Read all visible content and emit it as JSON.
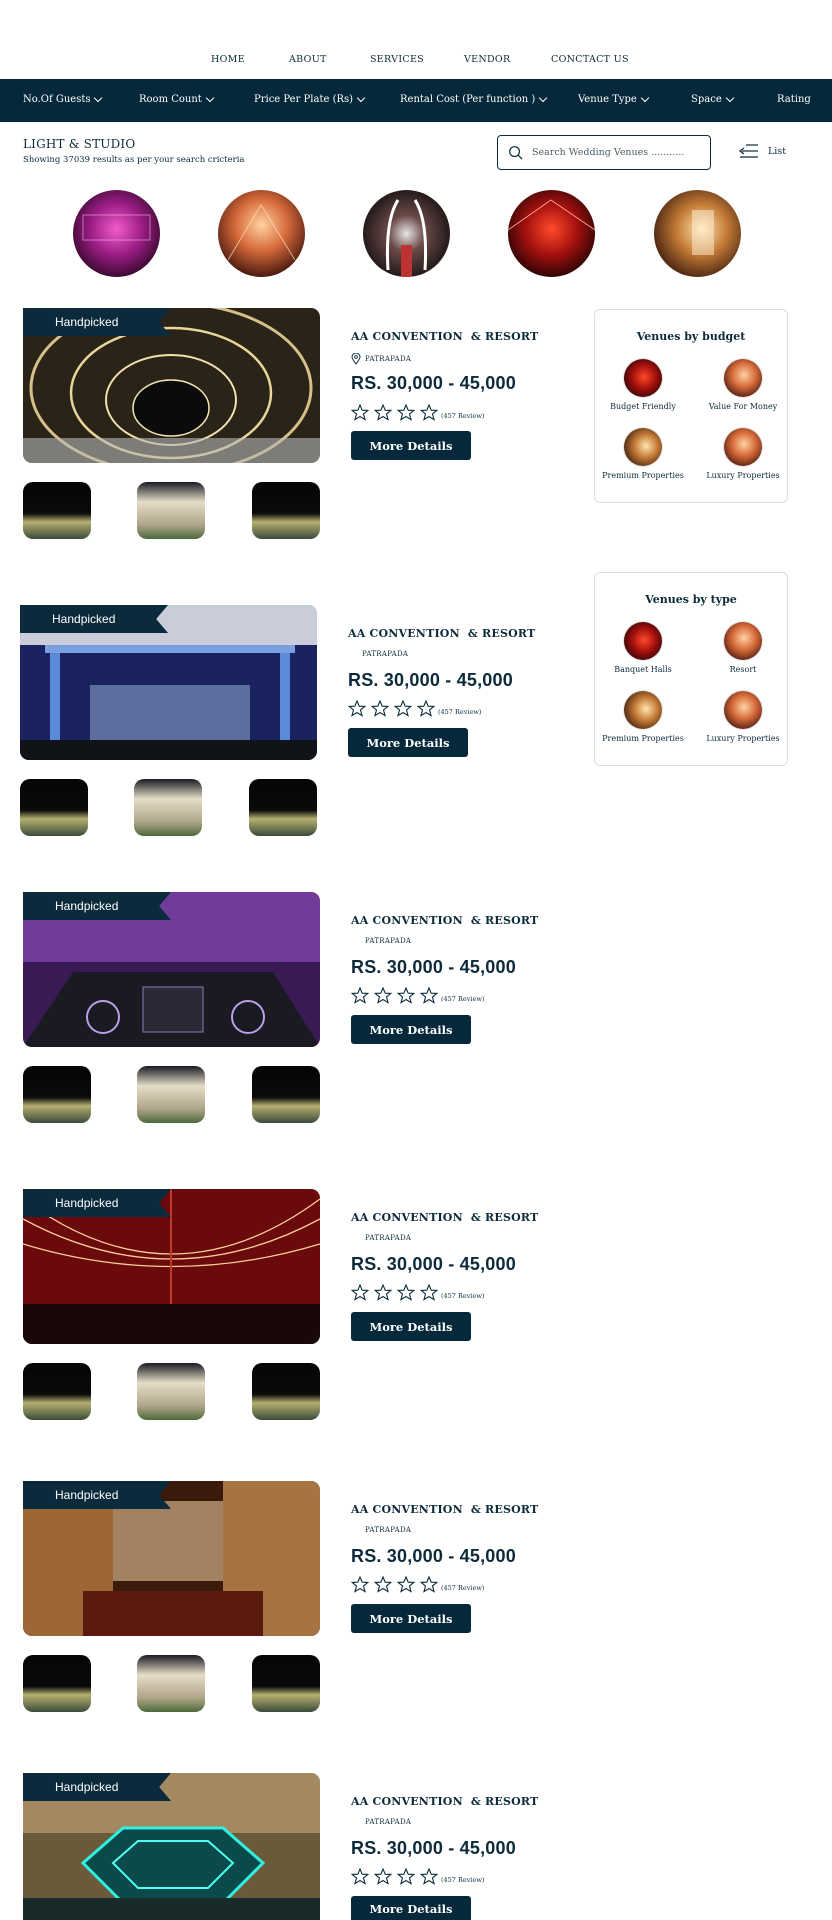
{
  "nav": [
    "HOME",
    "ABOUT",
    "SERVICES",
    "VENDOR",
    "CONCTACT US"
  ],
  "filters": [
    "No.Of Guests",
    "Room Count",
    "Price Per Plate (Rs)",
    "Rental Cost (Per function )",
    "Venue Type",
    "Space",
    "Rating"
  ],
  "results": {
    "title": "LIGHT & STUDIO",
    "subtitle": "Showing 37039 results as per your search cricteria"
  },
  "search": {
    "placeholder": "Search Wedding Venues ..........."
  },
  "view_toggle": {
    "label": "List"
  },
  "listings": [
    {
      "badge": "Handpicked",
      "name": "AA CONVENTION  & RESORT",
      "location": "PATRAPADA",
      "price": "RS. 30,000 - 45,000",
      "reviews": "(457 Review)",
      "button": "More Details"
    },
    {
      "badge": "Handpicked",
      "name": "AA CONVENTION  & RESORT",
      "location": "PATRAPADA",
      "price": "RS. 30,000 - 45,000",
      "reviews": "(457 Review)",
      "button": "More Details"
    },
    {
      "badge": "Handpicked",
      "name": "AA CONVENTION  & RESORT",
      "location": "PATRAPADA",
      "price": "RS. 30,000 - 45,000",
      "reviews": "(457 Review)",
      "button": "More Details"
    },
    {
      "badge": "Handpicked",
      "name": "AA CONVENTION  & RESORT",
      "location": "PATRAPADA",
      "price": "RS. 30,000 - 45,000",
      "reviews": "(457 Review)",
      "button": "More Details"
    },
    {
      "badge": "Handpicked",
      "name": "AA CONVENTION  & RESORT",
      "location": "PATRAPADA",
      "price": "RS. 30,000 - 45,000",
      "reviews": "(457 Review)",
      "button": "More Details"
    },
    {
      "badge": "Handpicked",
      "name": "AA CONVENTION  & RESORT",
      "location": "PATRAPADA",
      "price": "RS. 30,000 - 45,000",
      "reviews": "(457 Review)",
      "button": "More Details"
    }
  ],
  "budget_box": {
    "title": "Venues by budget",
    "items": [
      "Budget Friendly",
      "Value For Money",
      "Premium Properties",
      "Luxury Properties"
    ]
  },
  "type_box": {
    "title": "Venues by type",
    "items": [
      "Banquet Halls",
      "Resort",
      "Premium Properties",
      "Luxury Properties"
    ]
  },
  "colors": {
    "primary": "#06283b",
    "text": "#0c2a3a",
    "white": "#ffffff"
  },
  "icons": {
    "search": "search-icon",
    "list": "list-view-icon",
    "location": "location-pin-icon",
    "star": "star-outline-icon"
  }
}
